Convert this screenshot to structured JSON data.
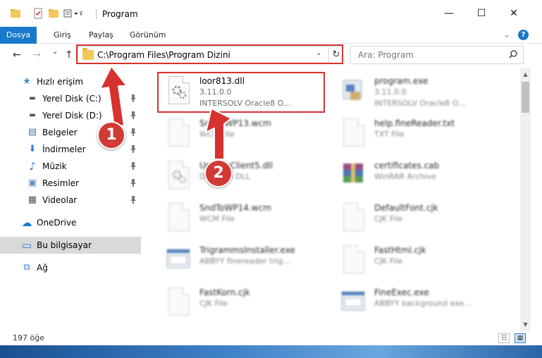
{
  "window": {
    "title": "Program",
    "minimize_glyph": "—",
    "maximize_glyph": "☐",
    "close_glyph": "✕"
  },
  "ribbon": {
    "tabs": [
      "Dosya",
      "Giriş",
      "Paylaş",
      "Görünüm"
    ],
    "expand_glyph": "⌄",
    "help_glyph": "?"
  },
  "address": {
    "path": "C:\\Program Files\\Program Dizini",
    "dropdown_glyph": "⌄",
    "refresh_glyph": "↻"
  },
  "search": {
    "placeholder": "Ara: Program",
    "icon": "search-icon"
  },
  "nav": {
    "back_glyph": "←",
    "forward_glyph": "→",
    "recent_glyph": "⌄",
    "up_glyph": "↑",
    "items": [
      {
        "label": "Hızlı erişim",
        "icon": "star-icon",
        "glyph": "★"
      },
      {
        "label": "Yerel Disk (C:)",
        "icon": "drive-icon",
        "glyph": "▬",
        "pin": "📌"
      },
      {
        "label": "Yerel Disk (D:)",
        "icon": "drive-icon",
        "glyph": "▬",
        "pin": "📌"
      },
      {
        "label": "Belgeler",
        "icon": "documents-icon",
        "glyph": "▤",
        "pin": "📌"
      },
      {
        "label": "İndirmeler",
        "icon": "download-icon",
        "glyph": "⬇",
        "pin": "📌"
      },
      {
        "label": "Müzik",
        "icon": "music-icon",
        "glyph": "♪",
        "pin": "📌"
      },
      {
        "label": "Resimler",
        "icon": "pictures-icon",
        "glyph": "▣",
        "pin": "📌"
      },
      {
        "label": "Videolar",
        "icon": "video-icon",
        "glyph": "▦",
        "pin": "📌"
      },
      {
        "label": "OneDrive",
        "icon": "cloud-icon",
        "glyph": "☁"
      },
      {
        "label": "Bu bilgisayar",
        "icon": "computer-icon",
        "glyph": "▭"
      },
      {
        "label": "Ağ",
        "icon": "network-icon",
        "glyph": "⧉"
      }
    ]
  },
  "files": [
    {
      "name": "loor813.dll",
      "line2": "3.11.0.0",
      "line3": "INTERSOLV Oracle8 O...",
      "icon": "dll-gear-icon"
    },
    {
      "name": "program.exe",
      "line2": "3.11.0.0",
      "line3": "INTERSOLV Oracle8 O...",
      "icon": "exe-icon"
    },
    {
      "name": "SndToWP13.wcm",
      "line2": "WCM File",
      "icon": "file-icon"
    },
    {
      "name": "help.fineReader.txt",
      "line2": "TXT File",
      "icon": "file-icon"
    },
    {
      "name": "UpdateClient5.dll",
      "line2": "Datasize DLL",
      "icon": "dll-gear-icon"
    },
    {
      "name": "certificates.cab",
      "line2": "WinRAR Archive",
      "icon": "winrar-icon"
    },
    {
      "name": "SndToWP14.wcm",
      "line2": "WCM File",
      "icon": "file-icon"
    },
    {
      "name": "DefaultFont.cjk",
      "line2": "CJK File",
      "icon": "file-icon"
    },
    {
      "name": "TrigrammsInstaller.exe",
      "line2": "ABBYY finereader trig...",
      "icon": "installer-icon"
    },
    {
      "name": "FastHtml.cjk",
      "line2": "CJK File",
      "icon": "file-icon"
    },
    {
      "name": "FastKorn.cjk",
      "line2": "CJK File",
      "icon": "file-icon"
    },
    {
      "name": "FineExec.exe",
      "line2": "ABBYY background exe...",
      "icon": "installer-icon"
    }
  ],
  "status": {
    "count": "197 öğe",
    "details_view_glyph": "☷",
    "icons_view_glyph": "▦"
  },
  "annotations": {
    "step1": "1",
    "step2": "2",
    "color": "#d7322f"
  }
}
